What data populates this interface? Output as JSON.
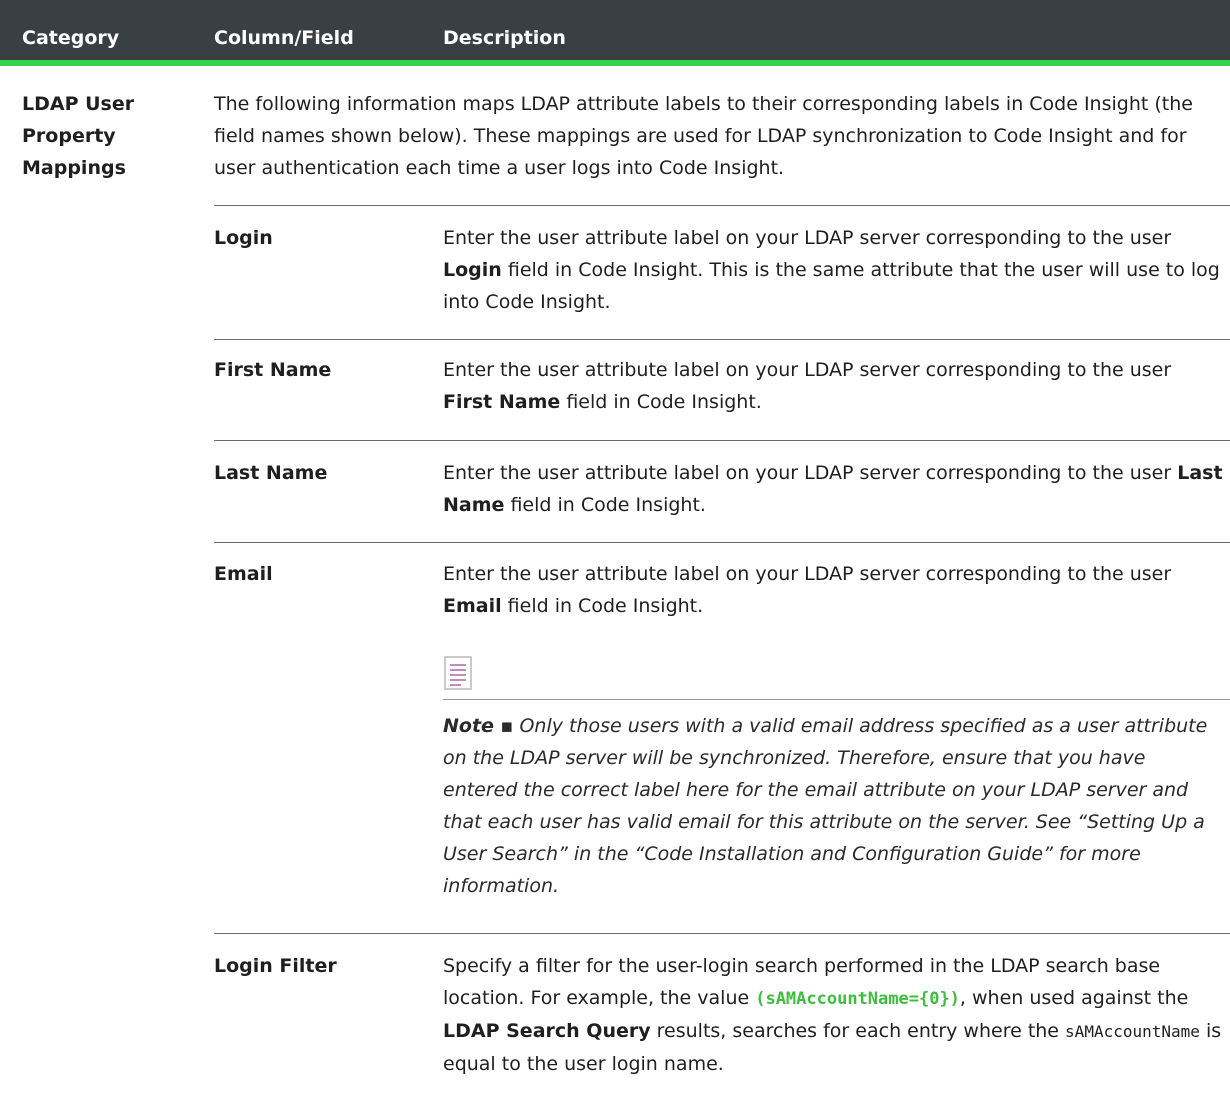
{
  "header": {
    "col1": "Category",
    "col2": "Column/Field",
    "col3": "Description"
  },
  "category": "LDAP User Property Mappings",
  "intro": "The following information maps LDAP attribute labels to their corresponding labels in Code Insight (the field names shown below). These mappings are used for LDAP synchronization to Code Insight and for user authentication each time a user logs into Code Insight.",
  "rows": [
    {
      "field": "Login",
      "desc_pre": "Enter the user attribute label on your LDAP server corresponding to the user ",
      "desc_bold": "Login",
      "desc_post": " field in Code Insight. This is the same attribute that the user will use to log into Code Insight."
    },
    {
      "field": "First Name",
      "desc_pre": "Enter the user attribute label on your LDAP server corresponding to the user ",
      "desc_bold": "First Name",
      "desc_post": " field in Code Insight."
    },
    {
      "field": "Last Name",
      "desc_pre": "Enter the user attribute label on your LDAP server corresponding to the user ",
      "desc_bold": "Last Name",
      "desc_post": " field in Code Insight."
    },
    {
      "field": "Email",
      "desc_pre": "Enter the user attribute label on your LDAP server corresponding to the user ",
      "desc_bold": "Email",
      "desc_post": " field in Code Insight.",
      "note_label": "Note ▪",
      "note_text": " Only those users with a valid email address specified as a user attribute on the LDAP server will be synchronized. Therefore, ensure that you have entered the correct label here for the email attribute on your LDAP server and that each user has valid email for this attribute on the server. See “Setting Up a User Search” in the “Code Installation and Configuration Guide” for more information."
    },
    {
      "field": "Login Filter",
      "desc_a": "Specify a filter for the user-login search performed in the LDAP search base location. For example, the value ",
      "desc_code": "(sAMAccountName={0})",
      "desc_b": ", when used against the ",
      "desc_bold": "LDAP Search Query",
      "desc_c": " results, searches for each entry where the ",
      "desc_code2": "sAMAccountName",
      "desc_d": " is equal to the user login name."
    }
  ],
  "icons": {
    "note": "note-document-icon"
  }
}
